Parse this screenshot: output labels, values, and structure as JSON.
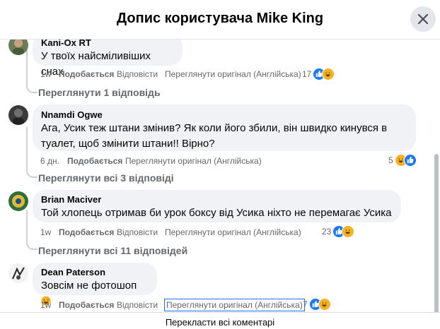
{
  "header": {
    "title": "Допис користувача Mike King"
  },
  "comments": [
    {
      "author": "Kani-Ox RT",
      "text": "У твоїх найсміливіших снах",
      "time": "1w",
      "like": "Подобається",
      "reply": "Відповісти",
      "translate": "Переглянути оригінал (Англійська)",
      "reactions_count": "17",
      "reactions": [
        "like-icon",
        "haha-icon"
      ],
      "replies_link": "Переглянути 1 відповідь"
    },
    {
      "author": "Nnamdi Ogwe",
      "text_lines": [
        "Ага, Усик теж штани змінив? Як коли його збили, він швидко кинувся в",
        "туалет, щоб змінити штани!! Вірно?"
      ],
      "time": "6 дн.",
      "like": "Подобається",
      "translate": "Переглянути оригінал (Англійська)",
      "reactions_count": "5",
      "reactions": [
        "haha-icon",
        "like-icon"
      ],
      "replies_link": "Переглянути всі 3 відповіді"
    },
    {
      "author": "Brian Maciver",
      "text": "Той хлопець отримав би урок боксу від Усика ніхто не перемагає Усика",
      "time": "1w",
      "like": "Подобається",
      "reply": "Відповісти",
      "translate": "Переглянути оригінал (Англійська)",
      "reactions_count": "23",
      "reactions": [
        "like-icon",
        "haha-icon"
      ],
      "replies_link": "Переглянути всі 11 відповідей"
    },
    {
      "author": "Dean Paterson",
      "text": "Зовсім не фотошоп",
      "emoji": "rofl-emoji",
      "time": "1w",
      "like": "Подобається",
      "reply": "Відповісти",
      "translate": "Переглянути оригінал (Англійська)",
      "reactions_count": "7",
      "reactions": [
        "like-icon",
        "haha-icon"
      ]
    }
  ],
  "footer": {
    "translate_all": "Перекласти всі коментарі"
  },
  "colors": {
    "bubble": "#f0f2f5",
    "accent": "#1877f2",
    "secondary_text": "#65676b",
    "haha": "#f7b125"
  }
}
